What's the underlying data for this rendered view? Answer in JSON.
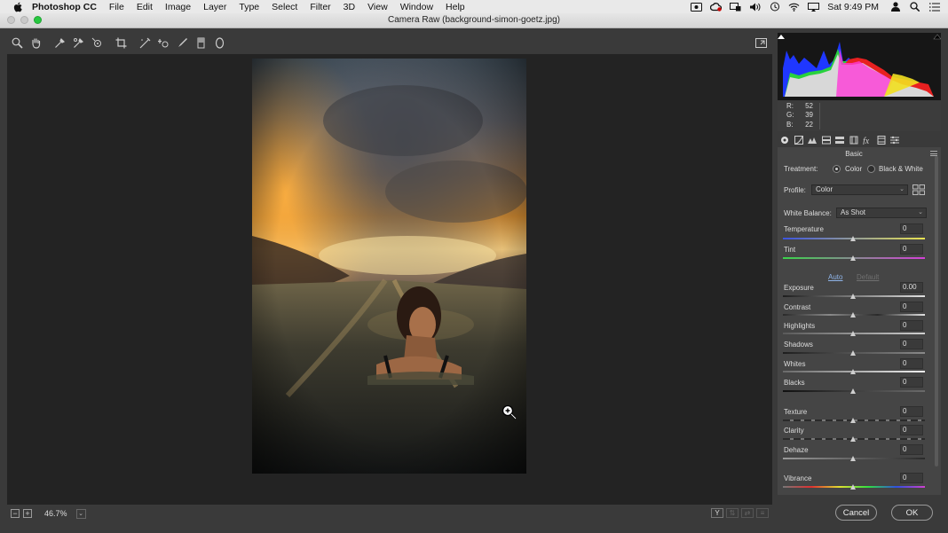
{
  "menubar": {
    "app_name": "Photoshop CC",
    "items": [
      "File",
      "Edit",
      "Image",
      "Layer",
      "Type",
      "Select",
      "Filter",
      "3D",
      "View",
      "Window",
      "Help"
    ],
    "clock": "Sat 9:49 PM",
    "status_icons": [
      "screen-record-icon",
      "creative-cloud-icon",
      "display-icon",
      "volume-icon",
      "time-machine-icon",
      "wifi-icon",
      "airplay-icon",
      "user-icon",
      "spotlight-icon",
      "notification-list-icon"
    ]
  },
  "window": {
    "title": "Camera Raw (background-simon-goetz.jpg)"
  },
  "toolbar": {
    "tools": [
      "zoom-tool-icon",
      "hand-tool-icon",
      "white-balance-tool-icon",
      "color-sampler-tool-icon",
      "targeted-adjustment-tool-icon",
      "crop-tool-icon",
      "straighten-tool-icon",
      "spot-removal-tool-icon",
      "adjustment-brush-icon",
      "graduated-filter-icon",
      "radial-filter-icon"
    ]
  },
  "status": {
    "zoom_level": "46.7%"
  },
  "readout": {
    "r_label": "R:",
    "r": "52",
    "g_label": "G:",
    "g": "39",
    "b_label": "B:",
    "b": "22"
  },
  "tabs": [
    "basic-tab-icon",
    "tone-curve-tab-icon",
    "detail-tab-icon",
    "hsl-tab-icon",
    "split-toning-tab-icon",
    "lens-corrections-tab-icon",
    "effects-tab-icon",
    "calibration-tab-icon",
    "presets-tab-icon"
  ],
  "panel": {
    "title": "Basic",
    "treatment_label": "Treatment:",
    "treatment_options": [
      "Color",
      "Black & White"
    ],
    "treatment_selected": "Color",
    "profile_label": "Profile:",
    "profile_value": "Color",
    "wb_label": "White Balance:",
    "wb_value": "As Shot",
    "auto_label": "Auto",
    "default_label": "Default",
    "sliders": [
      {
        "name": "Temperature",
        "value": "0"
      },
      {
        "name": "Tint",
        "value": "0"
      },
      {
        "name": "Exposure",
        "value": "0.00"
      },
      {
        "name": "Contrast",
        "value": "0"
      },
      {
        "name": "Highlights",
        "value": "0"
      },
      {
        "name": "Shadows",
        "value": "0"
      },
      {
        "name": "Whites",
        "value": "0"
      },
      {
        "name": "Blacks",
        "value": "0"
      },
      {
        "name": "Texture",
        "value": "0"
      },
      {
        "name": "Clarity",
        "value": "0"
      },
      {
        "name": "Dehaze",
        "value": "0"
      },
      {
        "name": "Vibrance",
        "value": "0"
      }
    ]
  },
  "footer": {
    "cancel_label": "Cancel",
    "ok_label": "OK"
  },
  "colors": {
    "accent_link": "#8fb4e8",
    "histogram_bg": "#161616",
    "canvas_bg": "#232323"
  }
}
